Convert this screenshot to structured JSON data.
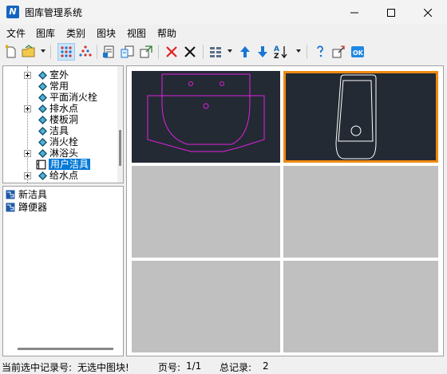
{
  "window": {
    "title": "图库管理系统",
    "app_icon_glyph": "N"
  },
  "menu": [
    "文件",
    "图库",
    "类别",
    "图块",
    "视图",
    "帮助"
  ],
  "toolbar_icons": [
    "new-icon",
    "open-folder-icon",
    "grid-dots-icon",
    "pyramid-icon",
    "insert-block-icon",
    "replace-block-icon",
    "export-block-icon",
    "delete-red-icon",
    "delete-black-icon",
    "view-layout-icon",
    "move-up-icon",
    "move-down-icon",
    "sort-az-icon",
    "help-icon",
    "properties-icon",
    "ok-icon"
  ],
  "tree": {
    "items": [
      {
        "label": "室外",
        "expandable": true
      },
      {
        "label": "常用",
        "expandable": false
      },
      {
        "label": "平面消火栓",
        "expandable": false
      },
      {
        "label": "排水点",
        "expandable": true
      },
      {
        "label": "楼板洞",
        "expandable": false
      },
      {
        "label": "洁具",
        "expandable": false
      },
      {
        "label": "消火栓",
        "expandable": false
      },
      {
        "label": "淋浴头",
        "expandable": true
      },
      {
        "label": "用户洁具",
        "expandable": false,
        "selected": true
      },
      {
        "label": "给水点",
        "expandable": true
      }
    ]
  },
  "list": {
    "items": [
      "新洁具",
      "蹲便器"
    ]
  },
  "grid": {
    "selected_index": 1,
    "colors": {
      "thumb_bg": "#232a33",
      "empty_cell": "#c0c0c0",
      "selection": "#f08a10",
      "basin_stroke": "#e020e0",
      "toilet_stroke": "#ffffff"
    }
  },
  "status": {
    "record_label": "当前选中记录号:",
    "record_value": "无选中图块!",
    "page_label": "页号:",
    "page_value": "1/1",
    "total_label": "总记录:",
    "total_value": "2"
  }
}
